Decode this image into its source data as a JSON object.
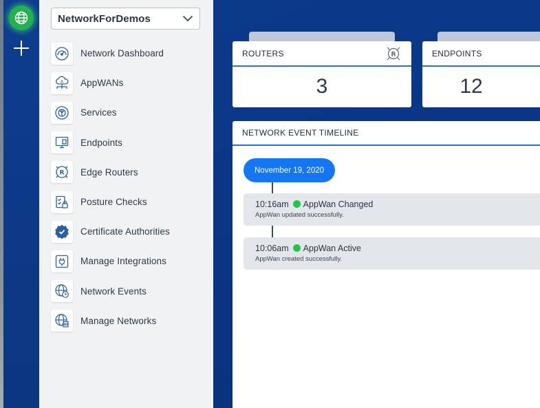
{
  "rail": {
    "globe_icon": "globe-icon",
    "add_icon": "plus-icon"
  },
  "sidebar": {
    "network_selector": {
      "value": "NetworkForDemos"
    },
    "items": [
      {
        "label": "Network Dashboard",
        "icon": "dashboard-gauge-icon"
      },
      {
        "label": "AppWANs",
        "icon": "cloud-network-icon"
      },
      {
        "label": "Services",
        "icon": "services-icon"
      },
      {
        "label": "Endpoints",
        "icon": "monitor-icon"
      },
      {
        "label": "Edge Routers",
        "icon": "router-icon"
      },
      {
        "label": "Posture Checks",
        "icon": "clipboard-lock-icon"
      },
      {
        "label": "Certificate Authorities",
        "icon": "certificate-badge-icon"
      },
      {
        "label": "Manage Integrations",
        "icon": "plug-icon"
      },
      {
        "label": "Network Events",
        "icon": "globe-clock-icon"
      },
      {
        "label": "Manage Networks",
        "icon": "globe-server-icon"
      }
    ]
  },
  "stats": {
    "routers": {
      "title": "ROUTERS",
      "value": "3"
    },
    "endpoints": {
      "title": "ENDPOINTS",
      "value": "12"
    }
  },
  "timeline": {
    "title": "NETWORK EVENT TIMELINE",
    "date": "November 19, 2020",
    "events": [
      {
        "time": "10:16am",
        "name": "AppWan Changed",
        "description": "AppWan updated successfully.",
        "status_color": "#22c74a"
      },
      {
        "time": "10:06am",
        "name": "AppWan Active",
        "description": "AppWan created successfully.",
        "status_color": "#22c74a"
      }
    ]
  },
  "colors": {
    "accent_blue": "#1476f2",
    "brand_navy": "#0a3a8a",
    "success_green": "#22c74a"
  }
}
